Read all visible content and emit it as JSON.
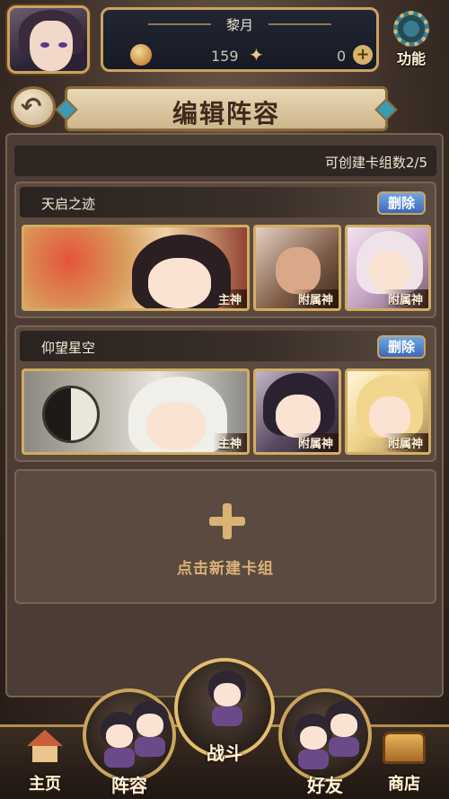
{
  "player": {
    "name": "黎月",
    "coins": "159",
    "gems": "0"
  },
  "menu": {
    "function_label": "功能"
  },
  "page": {
    "title": "编辑阵容"
  },
  "deck_count": "可创建卡组数2/5",
  "decks": [
    {
      "name": "天启之迹",
      "delete_label": "删除",
      "cards": [
        {
          "role": "主神"
        },
        {
          "role": "附属神"
        },
        {
          "role": "附属神"
        }
      ]
    },
    {
      "name": "仰望星空",
      "delete_label": "删除",
      "cards": [
        {
          "role": "主神"
        },
        {
          "role": "附属神"
        },
        {
          "role": "附属神"
        }
      ]
    }
  ],
  "new_deck_label": "点击新建卡组",
  "nav": {
    "home": "主页",
    "lineup": "阵容",
    "battle": "战斗",
    "friends": "好友",
    "shop": "商店"
  },
  "colors": {
    "gold_border": "#c9a45f",
    "delete_button": "#3a69b8",
    "panel": "#4b3d35",
    "accent_text": "#d9b274"
  }
}
